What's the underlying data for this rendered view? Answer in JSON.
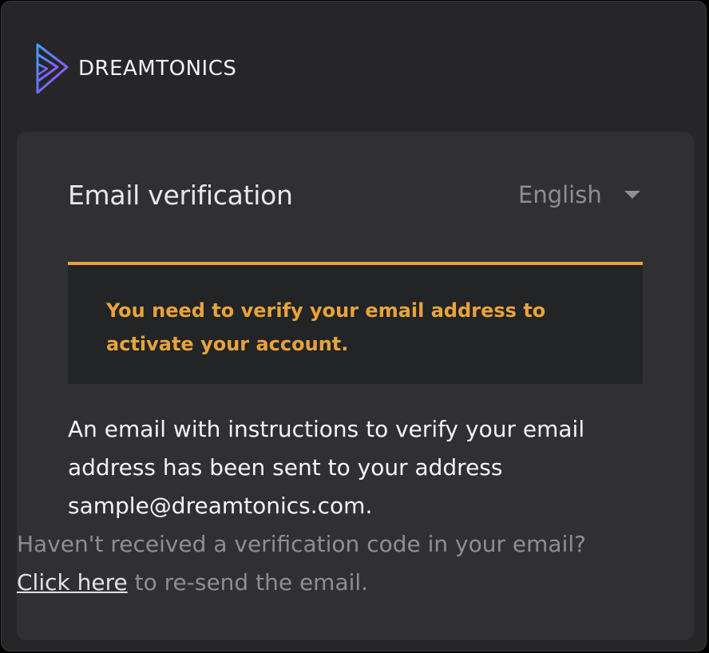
{
  "brand": {
    "name": "DREAMTONICS",
    "logo_icon": "dreamtonics-logo-icon"
  },
  "card": {
    "title": "Email verification",
    "language": {
      "selected": "English",
      "icon": "chevron-down-icon"
    },
    "alert": {
      "message": "You need to verify your email address to activate your account.",
      "accent_color": "#e8a33d"
    },
    "body": "An email with instructions to verify your email address has been sent to your address sample@dreamtonics.com.",
    "resend": {
      "question": "Haven't received a verification code in your email?",
      "link_label": "Click here",
      "suffix": " to re-send the email."
    }
  }
}
